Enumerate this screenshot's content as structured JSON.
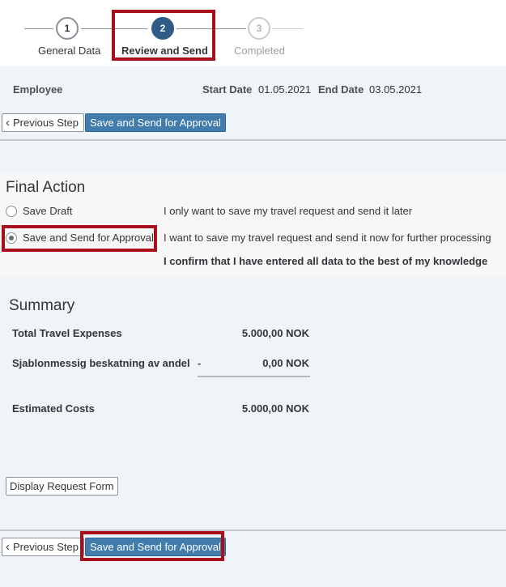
{
  "wizard": {
    "steps": [
      {
        "number": "1",
        "label": "General Data"
      },
      {
        "number": "2",
        "label": "Review and Send"
      },
      {
        "number": "3",
        "label": "Completed"
      }
    ]
  },
  "header": {
    "employee_label": "Employee",
    "start_date_label": "Start Date",
    "start_date_value": "01.05.2021",
    "end_date_label": "End Date",
    "end_date_value": "03.05.2021"
  },
  "toolbar": {
    "previous_label": "Previous Step",
    "save_send_label": "Save and Send for Approval"
  },
  "final_action": {
    "title": "Final Action",
    "options": [
      {
        "label": "Save Draft",
        "description": "I only want to save my travel request and send it later",
        "selected": false
      },
      {
        "label": "Save and Send for Approval",
        "description": "I want to save my travel request and send it now for further processing",
        "selected": true
      }
    ],
    "confirmation": "I confirm that I have entered all data to the best of my knowledge"
  },
  "summary": {
    "title": "Summary",
    "rows": [
      {
        "label": "Total Travel Expenses",
        "value": "5.000,00 NOK"
      },
      {
        "label": "Sjablonmessig beskatning av andel",
        "operator": "-",
        "value": "0,00 NOK"
      },
      {
        "label": "Estimated Costs",
        "value": "5.000,00 NOK"
      }
    ]
  },
  "display_form_label": "Display Request Form",
  "colors": {
    "accent": "#427cac",
    "active_step": "#2e5c86",
    "highlight": "#a80f1a"
  }
}
